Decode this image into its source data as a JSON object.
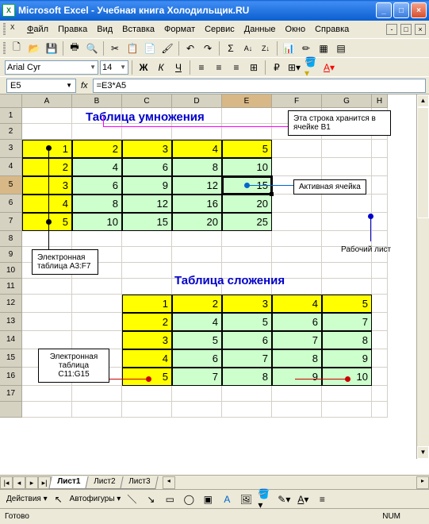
{
  "window": {
    "app": "Microsoft Excel",
    "doc": "Учебная книга Холодильщик.RU"
  },
  "menu": {
    "file": "Файл",
    "edit": "Правка",
    "view": "Вид",
    "insert": "Вставка",
    "format": "Формат",
    "tools": "Сервис",
    "data": "Данные",
    "window": "Окно",
    "help": "Справка"
  },
  "fmt": {
    "font": "Arial Cyr",
    "size": "14"
  },
  "ref": {
    "name": "E5",
    "formula": "=E3*A5"
  },
  "columns": [
    "A",
    "B",
    "C",
    "D",
    "E",
    "F",
    "G",
    "H"
  ],
  "titles": {
    "mult": "Таблица умножения",
    "add": "Таблица сложения"
  },
  "mult_table": [
    [
      1,
      2,
      3,
      4,
      5
    ],
    [
      2,
      4,
      6,
      8,
      10
    ],
    [
      3,
      6,
      9,
      12,
      15
    ],
    [
      4,
      8,
      12,
      16,
      20
    ],
    [
      5,
      10,
      15,
      20,
      25
    ]
  ],
  "add_table": [
    [
      1,
      2,
      3,
      4,
      5
    ],
    [
      2,
      4,
      5,
      6,
      7
    ],
    [
      3,
      5,
      6,
      7,
      8
    ],
    [
      4,
      6,
      7,
      8,
      9
    ],
    [
      5,
      7,
      8,
      9,
      10
    ]
  ],
  "callouts": {
    "b1": "Эта строка хранится в ячейке B1",
    "active": "Активная ячейка",
    "worksheet": "Рабочий лист",
    "range1": "Электронная таблица A3:F7",
    "range2": "Электронная таблица C11:G15"
  },
  "tabs": {
    "s1": "Лист1",
    "s2": "Лист2",
    "s3": "Лист3"
  },
  "draw": {
    "actions": "Действия",
    "autoshapes": "Автофигуры"
  },
  "status": {
    "ready": "Готово",
    "num": "NUM"
  }
}
